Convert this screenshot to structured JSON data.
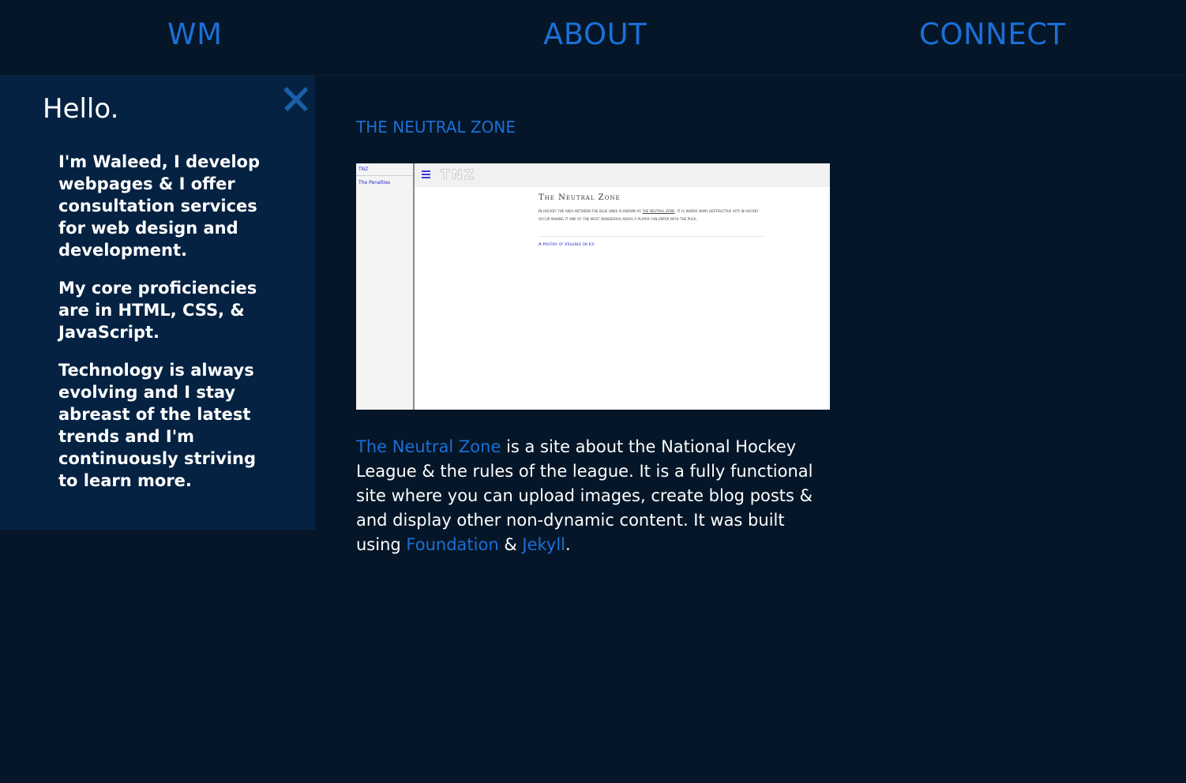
{
  "nav": {
    "home_label": "WM",
    "about_label": "ABOUT",
    "connect_label": "CONNECT"
  },
  "sidebar": {
    "title": "Hello.",
    "paragraphs": [
      "I'm Waleed, I develop webpages & I offer consultation services for web design and development.",
      "My core proficiencies are in HTML, CSS, & JavaScript.",
      "Technology is always evolving and I stay abreast of the latest trends and I'm continuously striving to learn more."
    ],
    "close_icon": "close-icon"
  },
  "project": {
    "title": "THE NEUTRAL ZONE",
    "screenshot": {
      "side_brand": "TNZ",
      "side_link": "The Penalties",
      "logo": "TNZ",
      "heading": "The Neutral Zone",
      "body_part1": "In hockey the area between the blue lines is known as ",
      "body_em1": "the neutral zone",
      "body_part2": ". It is where many ",
      "body_em2": "destructive hits",
      "body_part3": " in hockey occur making it one of the most dangerous areas a player can enter with the puck.",
      "link": "A History of Violence on Ice"
    },
    "description": {
      "link_name": "The Neutral Zone",
      "text1": " is a site about the National Hockey League & the rules of the league. It is a fully functional site where you can upload images, create blog posts & and display other non-dynamic content. It was built using ",
      "link_foundation": "Foundation",
      "amp": " & ",
      "link_jekyll": "Jekyll",
      "end": "."
    }
  },
  "colors": {
    "background": "#041628",
    "sidebar": "#052242",
    "accent": "#1c6fd6",
    "text": "#ffffff"
  }
}
